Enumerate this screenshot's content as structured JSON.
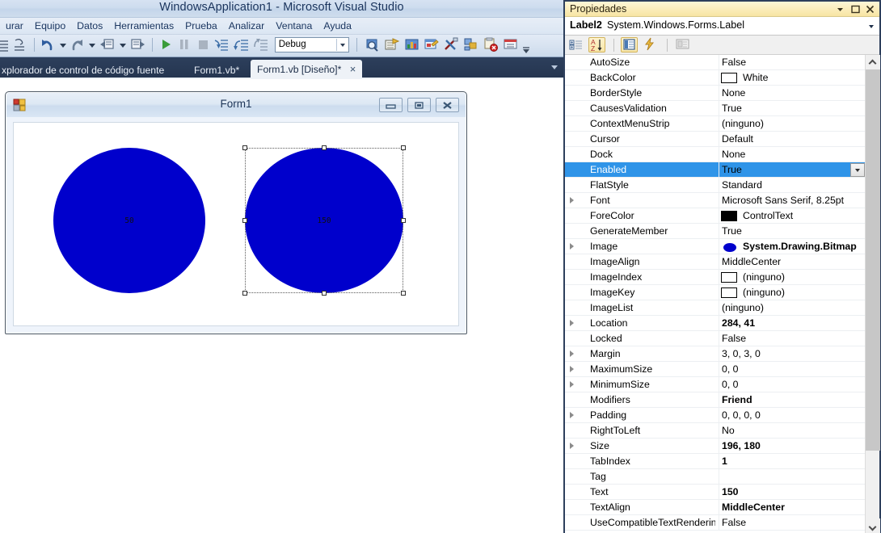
{
  "vs": {
    "title": "WindowsApplication1 - Microsoft Visual Studio",
    "menu": [
      "urar",
      "Equipo",
      "Datos",
      "Herramientas",
      "Prueba",
      "Analizar",
      "Ventana",
      "Ayuda"
    ],
    "toolbar": {
      "config_value": "Debug",
      "icons": [
        "list-icon",
        "comment-icon",
        "undo-icon",
        "undo-dropdown-icon",
        "redo-icon",
        "redo-dropdown-icon",
        "navigate-backward-icon",
        "navigate-dropdown-icon",
        "navigate-forward-icon",
        "start-debug-icon",
        "pause-icon",
        "stop-icon",
        "step-into-icon",
        "step-over-icon",
        "step-out-icon",
        "find-in-files-icon",
        "properties-window-icon",
        "object-browser-icon",
        "toolbox-icon",
        "tools-icon",
        "solution-explorer-icon",
        "error-list-icon",
        "output-window-icon",
        "toolbar-overflow-icon"
      ]
    },
    "tabs": [
      {
        "label": "xplorador de control de código fuente",
        "active": false
      },
      {
        "label": "Form1.vb*",
        "active": false
      },
      {
        "label": "Form1.vb [Diseño]*",
        "active": true,
        "close": "×"
      }
    ]
  },
  "form": {
    "title": "Form1",
    "buttons": [
      "minimize-button",
      "maximize-button",
      "close-button"
    ],
    "labels": [
      {
        "name": "Label1",
        "text": "50",
        "selected": false
      },
      {
        "name": "Label2",
        "text": "150",
        "selected": true
      }
    ]
  },
  "properties": {
    "panel_title": "Propiedades",
    "titlebar_buttons": [
      "dropdown-menu-icon",
      "maximize-icon",
      "close-icon"
    ],
    "object_name": "Label2",
    "object_type": "System.Windows.Forms.Label",
    "toolbar_icons": [
      "categorized-icon",
      "alphabetical-icon",
      "properties-icon",
      "events-icon",
      "property-pages-icon"
    ],
    "rows": [
      {
        "name": "AutoSize",
        "value": "False"
      },
      {
        "name": "BackColor",
        "value": "White",
        "swatch": "#ffffff"
      },
      {
        "name": "BorderStyle",
        "value": "None"
      },
      {
        "name": "CausesValidation",
        "value": "True"
      },
      {
        "name": "ContextMenuStrip",
        "value": "(ninguno)"
      },
      {
        "name": "Cursor",
        "value": "Default"
      },
      {
        "name": "Dock",
        "value": "None"
      },
      {
        "name": "Enabled",
        "value": "True",
        "selected": true,
        "dropdown": true
      },
      {
        "name": "FlatStyle",
        "value": "Standard"
      },
      {
        "name": "Font",
        "value": "Microsoft Sans Serif, 8.25pt",
        "expand": true
      },
      {
        "name": "ForeColor",
        "value": "ControlText",
        "swatch": "#000000"
      },
      {
        "name": "GenerateMember",
        "value": "True"
      },
      {
        "name": "Image",
        "value": "System.Drawing.Bitmap",
        "bold": true,
        "expand": true,
        "bitmap": true
      },
      {
        "name": "ImageAlign",
        "value": "MiddleCenter"
      },
      {
        "name": "ImageIndex",
        "value": "(ninguno)",
        "swatch": "#ffffff"
      },
      {
        "name": "ImageKey",
        "value": "(ninguno)",
        "swatch": "#ffffff"
      },
      {
        "name": "ImageList",
        "value": "(ninguno)"
      },
      {
        "name": "Location",
        "value": "284, 41",
        "bold": true,
        "expand": true
      },
      {
        "name": "Locked",
        "value": "False"
      },
      {
        "name": "Margin",
        "value": "3, 0, 3, 0",
        "expand": true
      },
      {
        "name": "MaximumSize",
        "value": "0, 0",
        "expand": true
      },
      {
        "name": "MinimumSize",
        "value": "0, 0",
        "expand": true
      },
      {
        "name": "Modifiers",
        "value": "Friend",
        "bold": true
      },
      {
        "name": "Padding",
        "value": "0, 0, 0, 0",
        "expand": true
      },
      {
        "name": "RightToLeft",
        "value": "No"
      },
      {
        "name": "Size",
        "value": "196, 180",
        "bold": true,
        "expand": true
      },
      {
        "name": "TabIndex",
        "value": "1",
        "bold": true
      },
      {
        "name": "Tag",
        "value": ""
      },
      {
        "name": "Text",
        "value": "150",
        "bold": true
      },
      {
        "name": "TextAlign",
        "value": "MiddleCenter",
        "bold": true
      },
      {
        "name": "UseCompatibleTextRendering",
        "value": "False"
      }
    ]
  },
  "colors": {
    "accent_blue": "#0000cc",
    "selection_blue": "#2f94e8",
    "titlebar_yellow": "#fbeebc",
    "tabstrip_navy": "#2d3f5c"
  }
}
